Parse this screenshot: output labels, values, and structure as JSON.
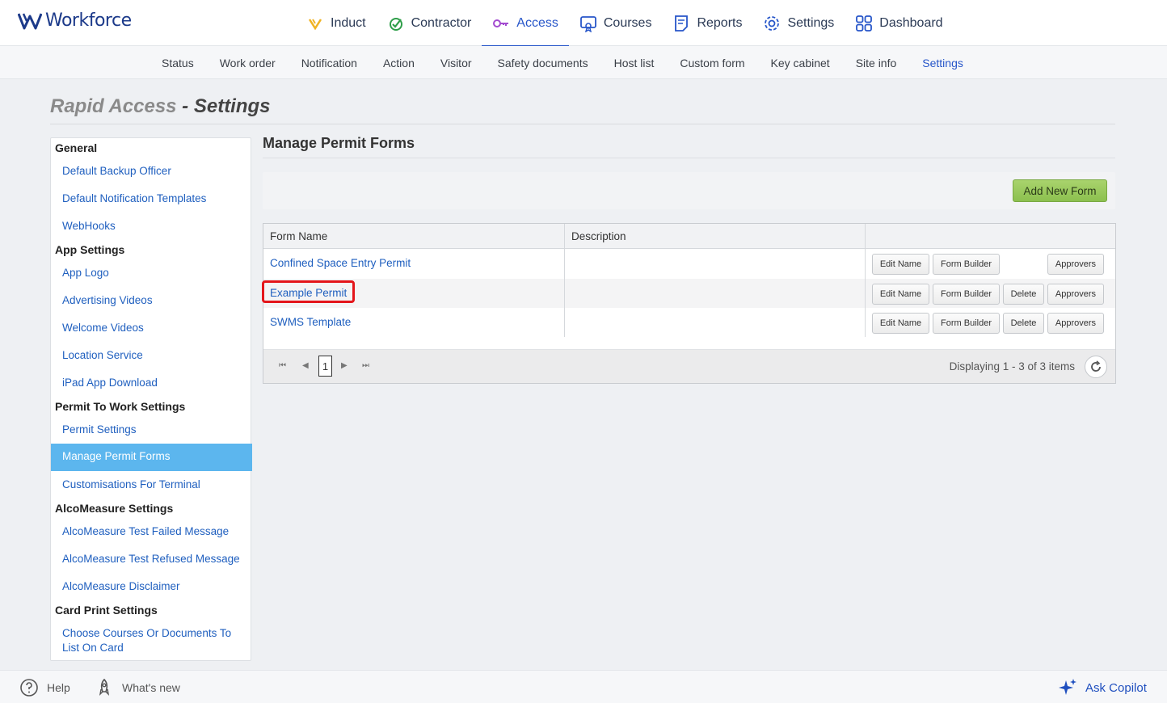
{
  "brand": {
    "name": "Workforce"
  },
  "main_nav": [
    {
      "label": "Induct",
      "icon": "induct-icon"
    },
    {
      "label": "Contractor",
      "icon": "contractor-icon"
    },
    {
      "label": "Access",
      "icon": "access-key-icon"
    },
    {
      "label": "Courses",
      "icon": "courses-icon"
    },
    {
      "label": "Reports",
      "icon": "reports-icon"
    },
    {
      "label": "Settings",
      "icon": "gear-icon"
    },
    {
      "label": "Dashboard",
      "icon": "dashboard-grid-icon"
    }
  ],
  "active_main": "Access",
  "sub_nav": [
    "Status",
    "Work order",
    "Notification",
    "Action",
    "Visitor",
    "Safety documents",
    "Host list",
    "Custom form",
    "Key cabinet",
    "Site info",
    "Settings"
  ],
  "active_sub": "Settings",
  "page": {
    "title_a": "Rapid Access",
    "title_sep": " - ",
    "title_b": "Settings"
  },
  "sidebar": {
    "general": "General",
    "default_backup_officer": "Default Backup Officer",
    "default_notification_templates": "Default Notification Templates",
    "webhooks": "WebHooks",
    "app_settings": "App Settings",
    "app_logo": "App Logo",
    "advertising_videos": "Advertising Videos",
    "welcome_videos": "Welcome Videos",
    "location_service": "Location Service",
    "ipad_app_download": "iPad App Download",
    "permit_to_work_settings": "Permit To Work Settings",
    "permit_settings": "Permit Settings",
    "manage_permit_forms": "Manage Permit Forms",
    "customisations_for_terminal": "Customisations For Terminal",
    "alcomeasure_settings": "AlcoMeasure Settings",
    "alco_failed": "AlcoMeasure Test Failed Message",
    "alco_refused": "AlcoMeasure Test Refused Message",
    "alco_disclaimer": "AlcoMeasure Disclaimer",
    "card_print_settings": "Card Print Settings",
    "choose_courses_1": "Choose Courses Or Documents To",
    "choose_courses_2": "List On Card"
  },
  "main": {
    "section_title": "Manage Permit Forms",
    "add_button": "Add New Form",
    "columns": {
      "form_name": "Form Name",
      "description": "Description"
    },
    "rows": [
      {
        "name": "Confined Space Entry Permit",
        "description": "",
        "edit": "Edit Name",
        "builder": "Form Builder",
        "approvers": "Approvers"
      },
      {
        "name": "Example Permit",
        "description": "",
        "edit": "Edit Name",
        "builder": "Form Builder",
        "delete": "Delete",
        "approvers": "Approvers"
      },
      {
        "name": "SWMS Template",
        "description": "",
        "edit": "Edit Name",
        "builder": "Form Builder",
        "delete": "Delete",
        "approvers": "Approvers"
      }
    ],
    "pager": {
      "current_page": "1",
      "info": "Displaying 1 - 3 of 3 items"
    }
  },
  "footer": {
    "help": "Help",
    "whats_new": "What's new",
    "copilot": "Ask Copilot"
  },
  "colors": {
    "accent": "#2756c9",
    "active_sidebar": "#5cb6ee",
    "add_button": "#9ccb5e",
    "highlight": "#e4161b"
  }
}
